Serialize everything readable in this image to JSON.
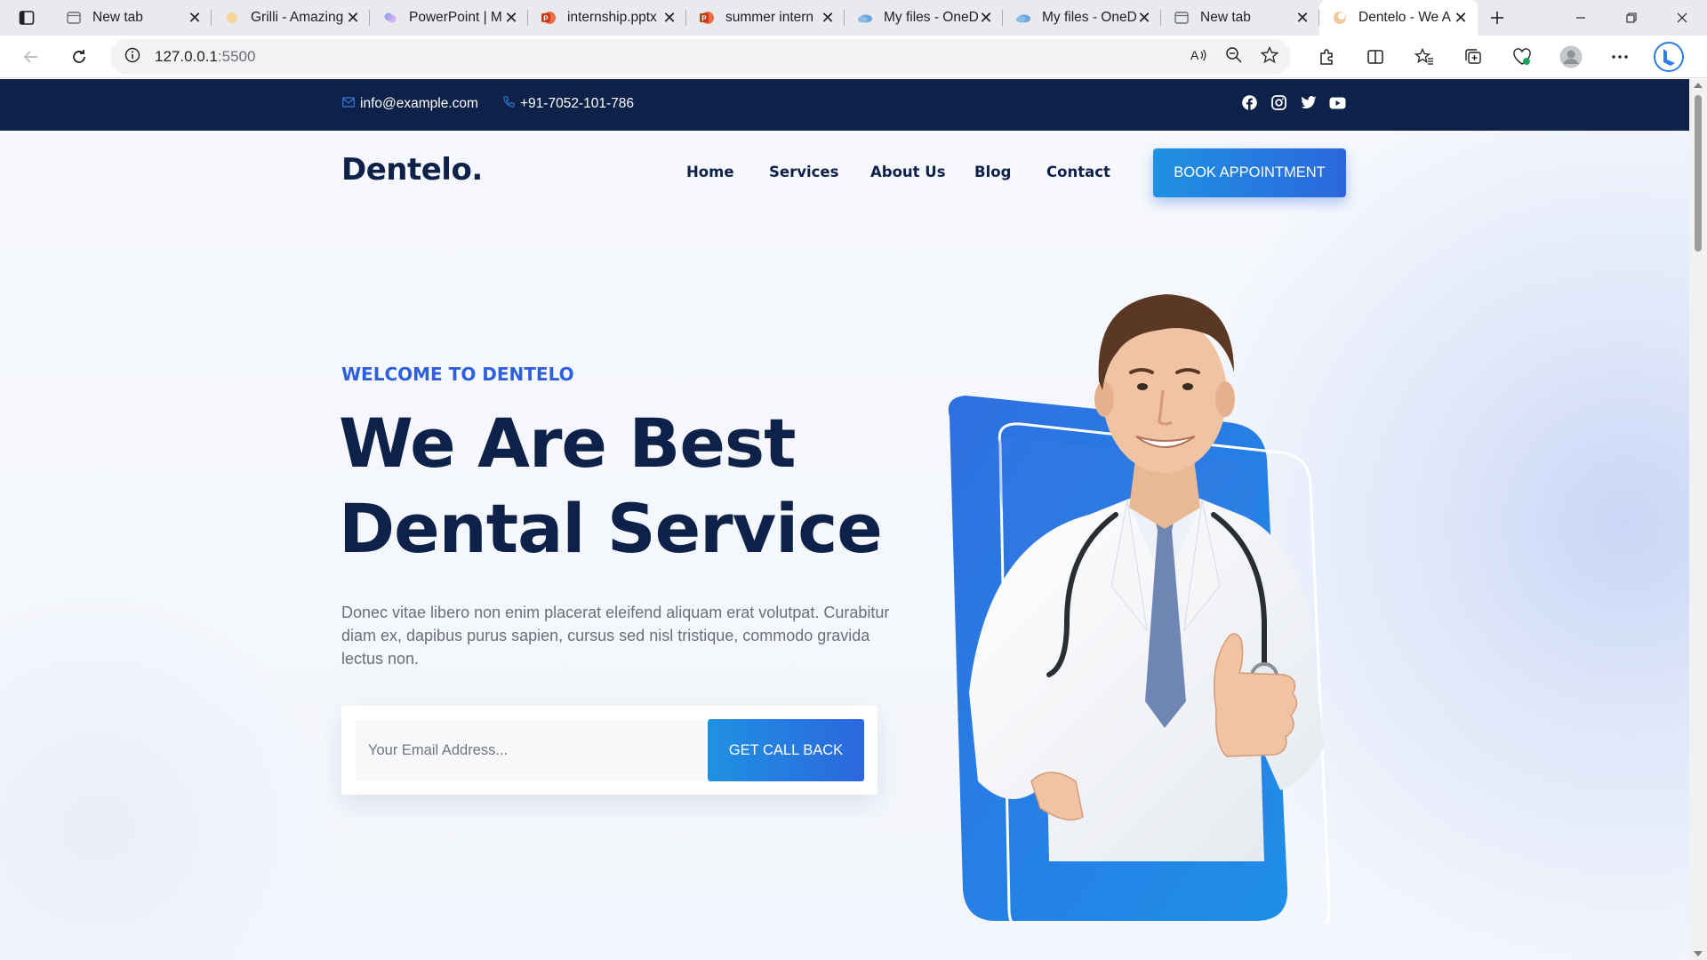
{
  "browser": {
    "tabs": [
      {
        "title": "New tab",
        "icon": "page-icon"
      },
      {
        "title": "Grilli - Amazing",
        "icon": "sun-icon"
      },
      {
        "title": "PowerPoint | M",
        "icon": "copilot-icon"
      },
      {
        "title": "internship.pptx",
        "icon": "powerpoint-icon"
      },
      {
        "title": "summer intern",
        "icon": "powerpoint-icon"
      },
      {
        "title": "My files - OneD",
        "icon": "onedrive-icon"
      },
      {
        "title": "My files - OneD",
        "icon": "onedrive-icon"
      },
      {
        "title": "New tab",
        "icon": "page-icon"
      },
      {
        "title": "Dentelo - We A",
        "icon": "dentelo-icon",
        "active": true
      }
    ],
    "url_host": "127.0.0.1",
    "url_port": ":5500"
  },
  "site": {
    "topbar": {
      "email": "info@example.com",
      "phone": "+91-7052-101-786",
      "social": [
        "facebook-icon",
        "instagram-icon",
        "twitter-icon",
        "youtube-icon"
      ]
    },
    "logo": "Dentelo.",
    "nav": [
      {
        "label": "Home"
      },
      {
        "label": "Services"
      },
      {
        "label": "About Us"
      },
      {
        "label": "Blog"
      },
      {
        "label": "Contact"
      }
    ],
    "cta_label": "BOOK APPOINTMENT",
    "hero": {
      "eyebrow": "WELCOME TO DENTELO",
      "title_line1": "We Are Best",
      "title_line2": "Dental Service",
      "description": "Donec vitae libero non enim placerat eleifend aliquam erat volutpat. Curabitur diam ex, dapibus purus sapien, cursus sed nisl tristique, commodo gravida lectus non.",
      "email_placeholder": "Your Email Address...",
      "button_label": "GET CALL BACK"
    },
    "colors": {
      "navy": "#0e2249",
      "accent_blue": "#2f5fda",
      "gradient_start": "#1f91e2",
      "gradient_end": "#2c67dd"
    }
  }
}
